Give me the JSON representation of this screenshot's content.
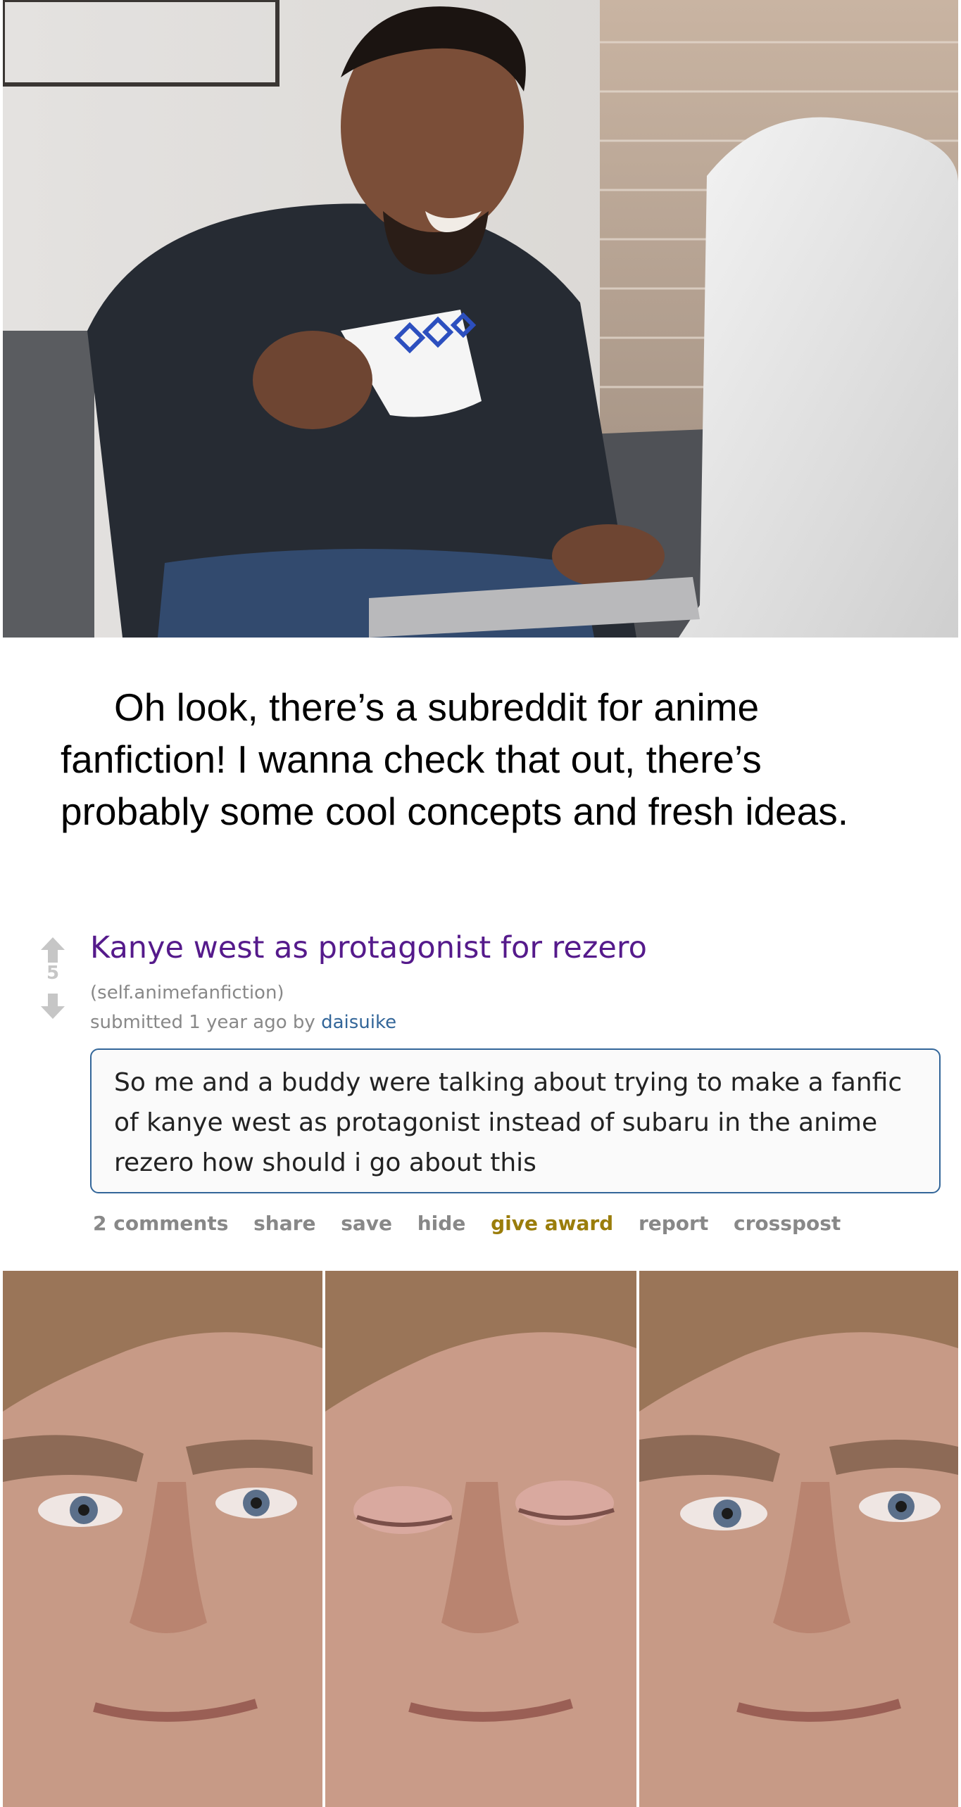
{
  "caption": "Oh look, there’s a subreddit for anime fanfiction! I wanna check that out, there’s probably some cool concepts and fresh ideas.",
  "post": {
    "score": "5",
    "title": "Kanye west as protagonist for rezero",
    "domain": "(self.animefanfiction)",
    "tagline_prefix": "submitted 1 year ago by",
    "author": "daisuike",
    "selftext": "So me and a buddy were talking about trying to make a fanfic of kanye west as protagonist instead of subaru in the anime rezero how should i go about this",
    "buttons": {
      "comments": "2 comments",
      "share": "share",
      "save": "save",
      "hide": "hide",
      "give_award": "give award",
      "report": "report",
      "crosspost": "crosspost"
    },
    "colors": {
      "title": "#551a8b",
      "meta": "#888888",
      "author": "#336699",
      "award": "#9a7d0a",
      "selftext_border": "#336699"
    }
  },
  "icons": [
    "upvote-icon",
    "downvote-icon"
  ]
}
